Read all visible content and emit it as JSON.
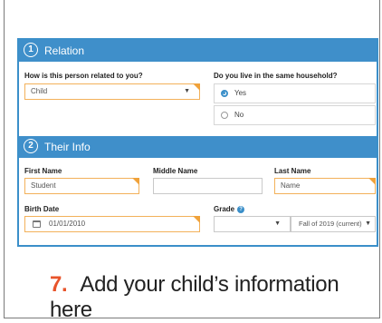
{
  "relation": {
    "section_number": "1",
    "section_title": "Relation",
    "related_label": "How is this person related to you?",
    "related_value": "Child",
    "household_label": "Do you live in the same household?",
    "options": [
      "Yes",
      "No"
    ],
    "selected": "Yes"
  },
  "their_info": {
    "section_number": "2",
    "section_title": "Their Info",
    "first_name_label": "First Name",
    "first_name_value": "Student",
    "middle_name_label": "Middle Name",
    "middle_name_value": "",
    "last_name_label": "Last Name",
    "last_name_value": "Name",
    "birth_date_label": "Birth Date",
    "birth_date_value": "01/01/2010",
    "grade_label": "Grade",
    "grade_value": "",
    "term_value": "Fall of 2019 (current)"
  },
  "instruction": {
    "number": "7.",
    "text": "Add your child’s information here"
  },
  "colors": {
    "header_blue": "#3f8fca",
    "highlight_orange": "#f0a23a",
    "step_number": "#e8542b"
  }
}
